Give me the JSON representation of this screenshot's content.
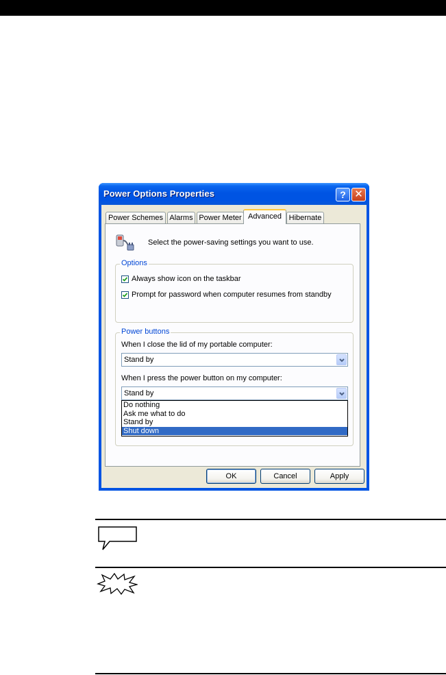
{
  "dialog": {
    "title": "Power Options Properties",
    "help_glyph": "?",
    "close_glyph": "✕",
    "tabs": [
      {
        "label": "Power Schemes",
        "active": false
      },
      {
        "label": "Alarms",
        "active": false
      },
      {
        "label": "Power Meter",
        "active": false
      },
      {
        "label": "Advanced",
        "active": true
      },
      {
        "label": "Hibernate",
        "active": false
      }
    ],
    "intro_text": "Select the power-saving settings you want to use.",
    "options_group": {
      "label": "Options",
      "checkboxes": [
        {
          "label": "Always show icon on the taskbar",
          "checked": true
        },
        {
          "label": "Prompt for password when computer resumes from standby",
          "checked": true
        }
      ]
    },
    "power_buttons_group": {
      "label": "Power buttons",
      "lid_label": "When I close the lid of my portable computer:",
      "lid_value": "Stand by",
      "power_label": "When I press the power button on my computer:",
      "power_value": "Stand by",
      "power_options": [
        "Do nothing",
        "Ask me what to do",
        "Stand by",
        "Shut down"
      ],
      "highlighted_option": "Shut down"
    },
    "buttons": {
      "ok": "OK",
      "cancel": "Cancel",
      "apply": "Apply"
    }
  },
  "colors": {
    "titlebar": "#0054e3",
    "dialog_face": "#ece9d8",
    "selection": "#316ac5",
    "group_label": "#0046d5"
  }
}
